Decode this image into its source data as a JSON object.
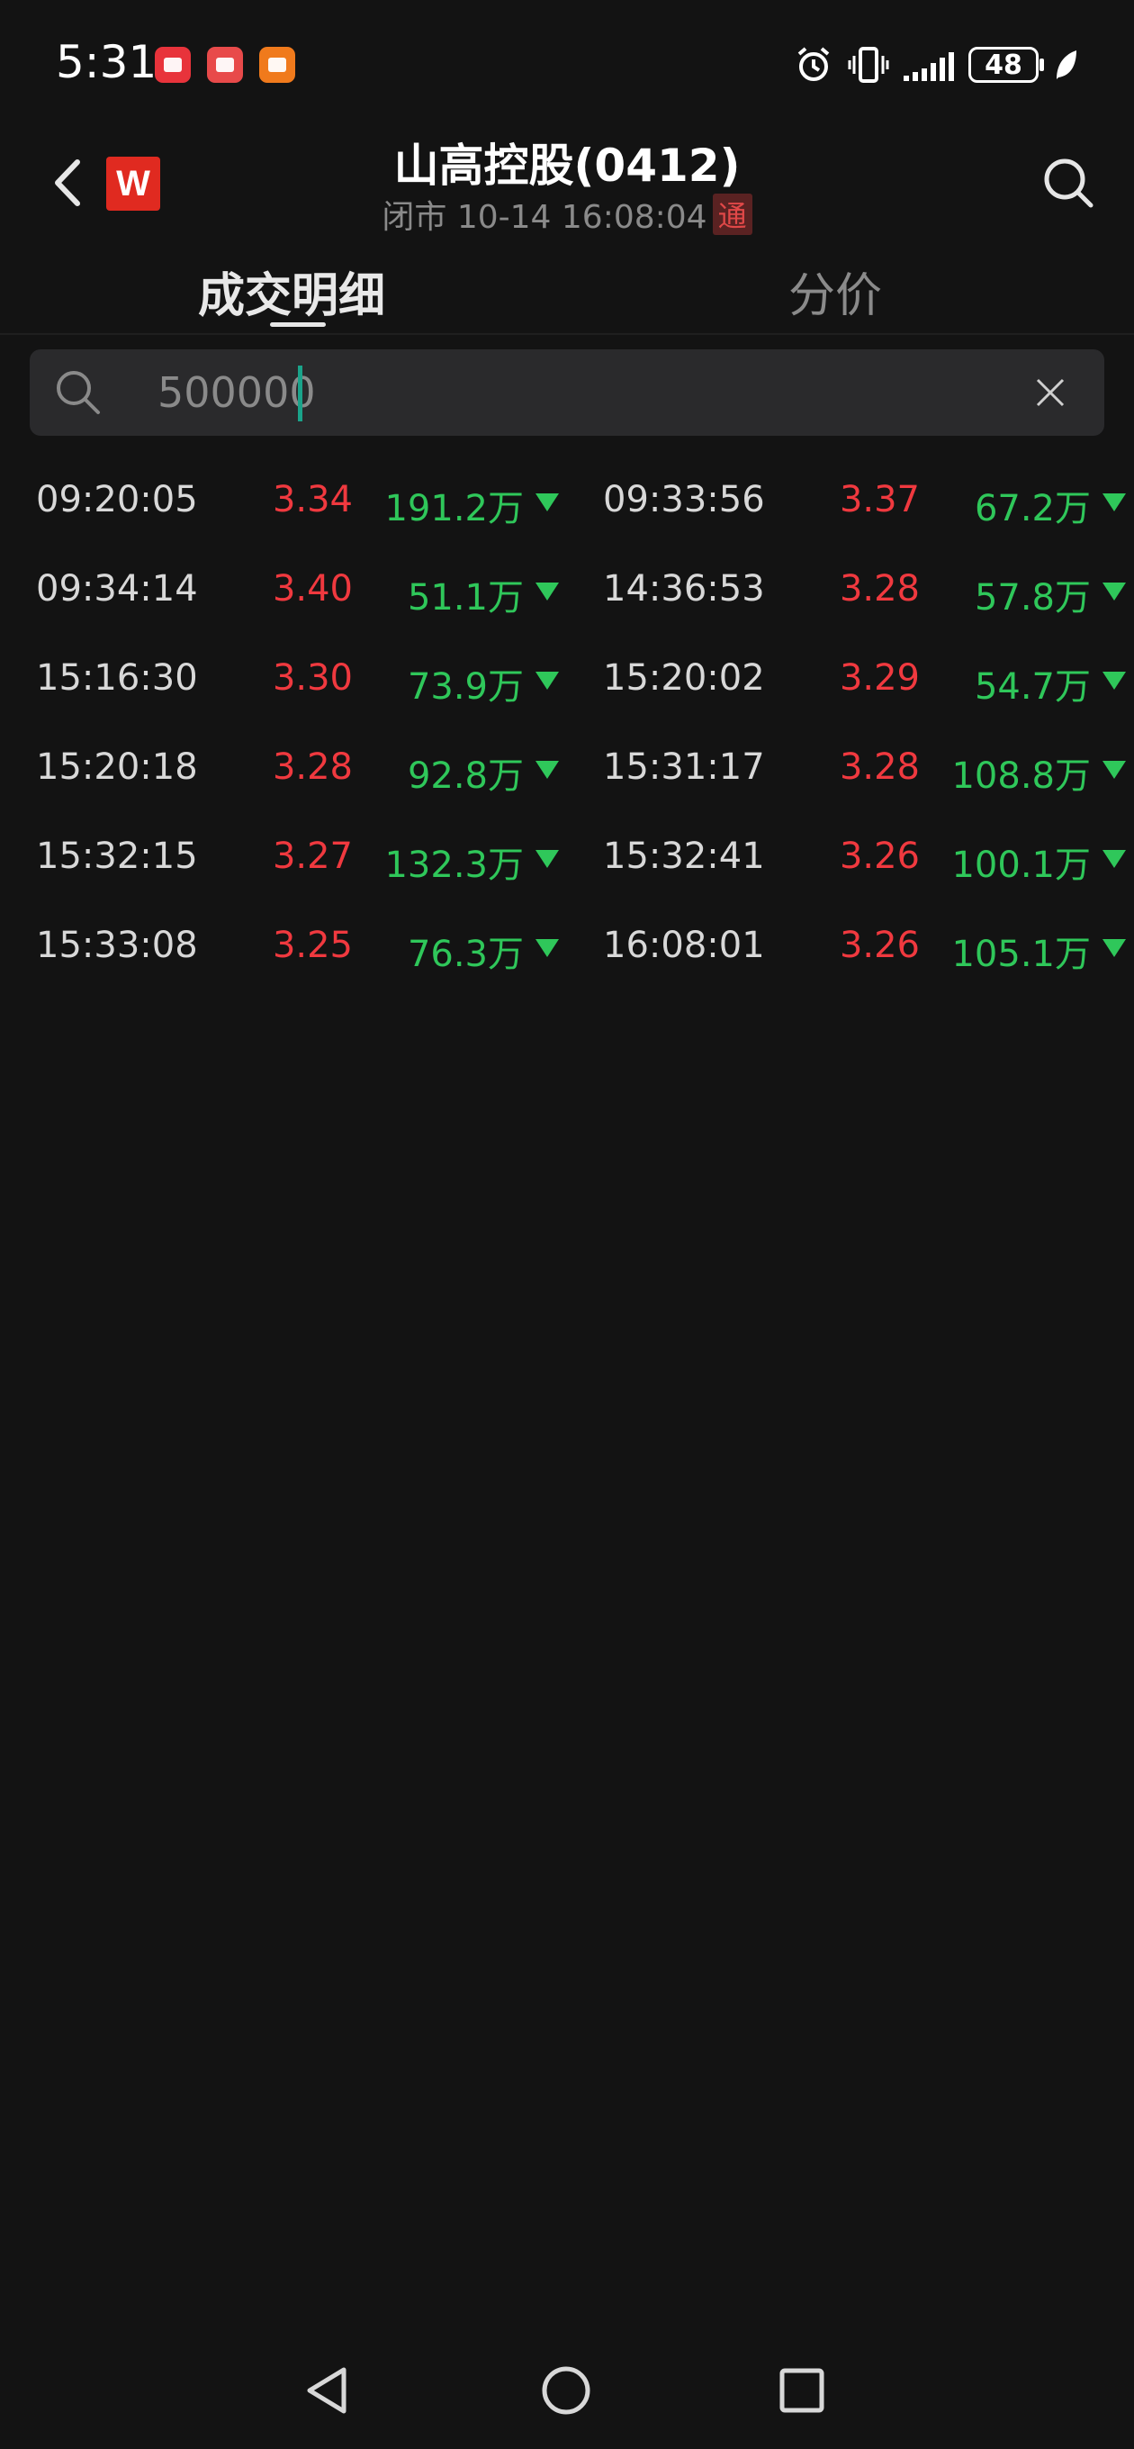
{
  "status_bar": {
    "time": "5:31",
    "battery": "48",
    "icons": [
      "huawei-appgallery-icon",
      "reader-app-icon",
      "wallet-app-icon",
      "alarm-icon",
      "vibrate-icon",
      "signal-icon",
      "battery-icon",
      "leaf-icon"
    ]
  },
  "header": {
    "title": "山高控股(0412)",
    "status_text": "闭市 10-14 16:08:04",
    "badge": "通",
    "logo": "W"
  },
  "tabs": [
    {
      "label": "成交明细",
      "active": true
    },
    {
      "label": "分价",
      "active": false
    }
  ],
  "search": {
    "value": "500000"
  },
  "trades": [
    {
      "time": "09:20:05",
      "price": "3.34",
      "volume": "191.2万"
    },
    {
      "time": "09:33:56",
      "price": "3.37",
      "volume": "67.2万"
    },
    {
      "time": "09:34:14",
      "price": "3.40",
      "volume": "51.1万"
    },
    {
      "time": "14:36:53",
      "price": "3.28",
      "volume": "57.8万"
    },
    {
      "time": "15:16:30",
      "price": "3.30",
      "volume": "73.9万"
    },
    {
      "time": "15:20:02",
      "price": "3.29",
      "volume": "54.7万"
    },
    {
      "time": "15:20:18",
      "price": "3.28",
      "volume": "92.8万"
    },
    {
      "time": "15:31:17",
      "price": "3.28",
      "volume": "108.8万"
    },
    {
      "time": "15:32:15",
      "price": "3.27",
      "volume": "132.3万"
    },
    {
      "time": "15:32:41",
      "price": "3.26",
      "volume": "100.1万"
    },
    {
      "time": "15:33:08",
      "price": "3.25",
      "volume": "76.3万"
    },
    {
      "time": "16:08:01",
      "price": "3.26",
      "volume": "105.1万"
    }
  ],
  "colors": {
    "background": "#131313",
    "price_up": "#f0393f",
    "volume_down": "#2fc75a",
    "caret": "#1aa38a"
  }
}
